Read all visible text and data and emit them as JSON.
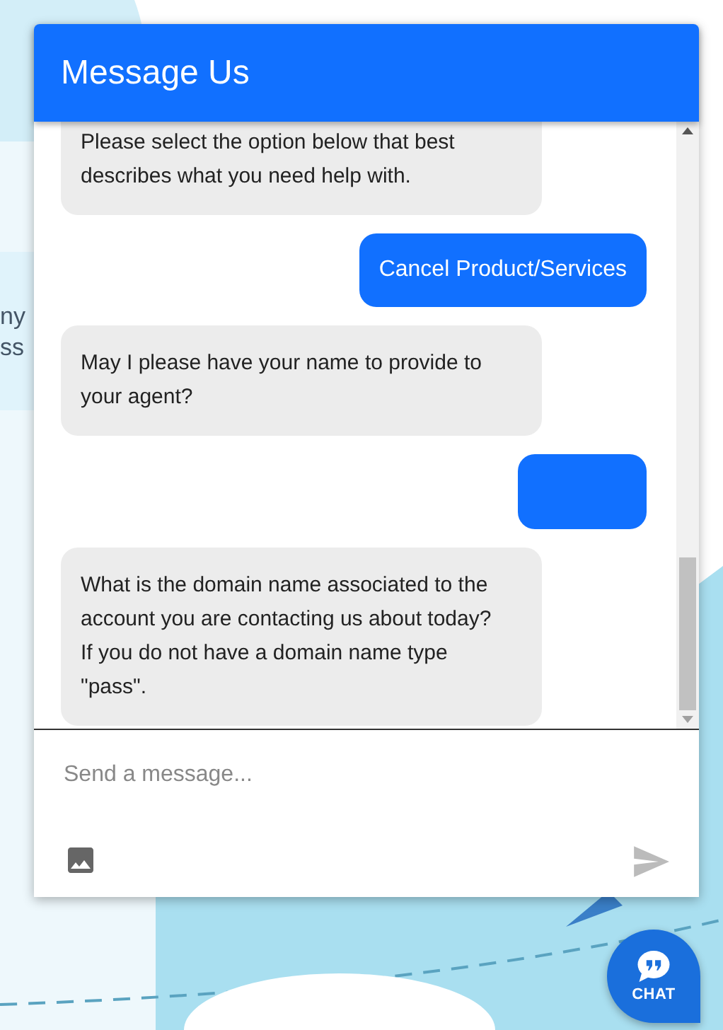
{
  "background": {
    "text_fragments": [
      "ny",
      "ss"
    ]
  },
  "chat_window": {
    "title": "Message Us",
    "messages": [
      {
        "kind": "bot",
        "text": "Please select the option below that best describes what you need help with."
      },
      {
        "kind": "user",
        "text": "Cancel Product/Services"
      },
      {
        "kind": "bot",
        "text": "May I please have your name to provide to your agent?"
      },
      {
        "kind": "user"
      },
      {
        "kind": "bot",
        "text": "What is the domain name associated to the account you are contacting us about today? If you do not have a domain name type \"pass\"."
      }
    ],
    "composer": {
      "placeholder": "Send a message..."
    }
  },
  "chat_launcher": {
    "label": "CHAT"
  }
}
